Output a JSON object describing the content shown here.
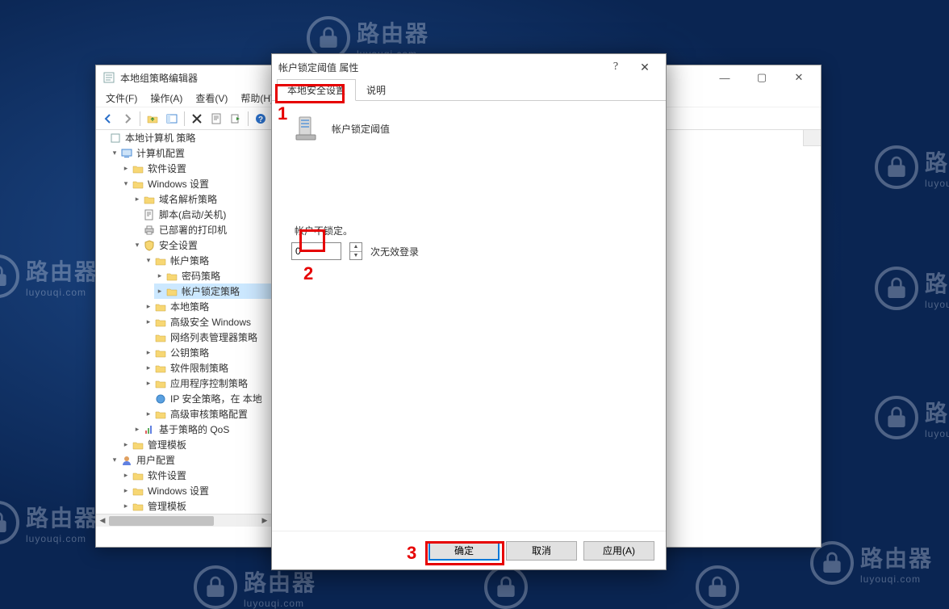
{
  "watermark": {
    "label1": "路由器",
    "label2": "luyouqi.com"
  },
  "editor": {
    "title": "本地组策略编辑器",
    "menus": {
      "file": "文件(F)",
      "action": "操作(A)",
      "view": "查看(V)",
      "help": "帮助(H)"
    },
    "tree": {
      "root": "本地计算机 策略",
      "computer_config": "计算机配置",
      "software_settings": "软件设置",
      "windows_settings": "Windows 设置",
      "dns_policy": "域名解析策略",
      "scripts": "脚本(启动/关机)",
      "deployed_printers": "已部署的打印机",
      "security_settings": "安全设置",
      "account_policies": "帐户策略",
      "password_policy": "密码策略",
      "account_lockout_policy": "帐户锁定策略",
      "local_policies": "本地策略",
      "advanced_windows": "高级安全 Windows",
      "network_list": "网络列表管理器策略",
      "public_key": "公钥策略",
      "software_restriction": "软件限制策略",
      "app_control": "应用程序控制策略",
      "ip_security": "IP 安全策略，在 本地",
      "advanced_audit": "高级审核策略配置",
      "policy_qos": "基于策略的 QoS",
      "admin_templates": "管理模板",
      "user_config": "用户配置",
      "user_software": "软件设置",
      "user_windows": "Windows 设置",
      "user_admin_templates": "管理模板"
    }
  },
  "dialog": {
    "title": "帐户锁定阈值 属性",
    "tabs": {
      "security": "本地安全设置",
      "explain": "说明"
    },
    "heading": "帐户锁定阈值",
    "no_lock_label": "帐户不锁定。",
    "threshold_value": "0",
    "invalid_attempts_label": "次无效登录",
    "buttons": {
      "ok": "确定",
      "cancel": "取消",
      "apply": "应用(A)"
    }
  },
  "annotations": {
    "n1": "1",
    "n2": "2",
    "n3": "3"
  }
}
